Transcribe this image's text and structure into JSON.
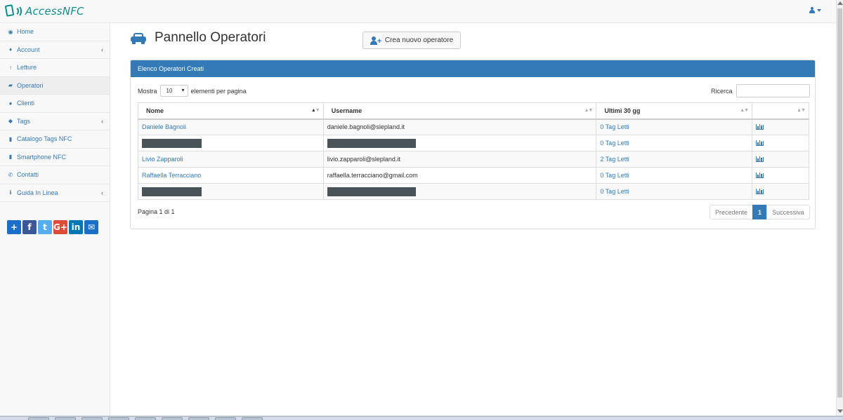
{
  "app": {
    "name": "AccessNFC"
  },
  "sidebar": {
    "items": [
      {
        "label": "Home",
        "icon": "dashboard-icon",
        "glyph": "◉",
        "arrow": ""
      },
      {
        "label": "Account",
        "icon": "male-icon",
        "glyph": "♦",
        "arrow": "‹"
      },
      {
        "label": "Letture",
        "icon": "arrow-up-icon",
        "glyph": "↑",
        "arrow": ""
      },
      {
        "label": "Operatori",
        "icon": "car-icon",
        "glyph": "▰",
        "arrow": ""
      },
      {
        "label": "Clienti",
        "icon": "users-icon",
        "glyph": "●",
        "arrow": ""
      },
      {
        "label": "Tags",
        "icon": "tag-icon",
        "glyph": "◆",
        "arrow": "‹"
      },
      {
        "label": "Catalogo Tags NFC",
        "icon": "book-icon",
        "glyph": "▮",
        "arrow": ""
      },
      {
        "label": "Smartphone NFC",
        "icon": "book-icon",
        "glyph": "▮",
        "arrow": ""
      },
      {
        "label": "Contatti",
        "icon": "phone-icon",
        "glyph": "✆",
        "arrow": ""
      },
      {
        "label": "Guida In Linea",
        "icon": "info-circle-icon",
        "glyph": "ℹ",
        "arrow": "‹"
      }
    ],
    "social": [
      {
        "name": "share-plus-icon",
        "glyph": "+",
        "color": "#1c6fc9"
      },
      {
        "name": "facebook-icon",
        "glyph": "f",
        "color": "#3b5998"
      },
      {
        "name": "twitter-icon",
        "glyph": "t",
        "color": "#55acee"
      },
      {
        "name": "google-plus-icon",
        "glyph": "G+",
        "color": "#dd4b39"
      },
      {
        "name": "linkedin-icon",
        "glyph": "in",
        "color": "#0077b5"
      },
      {
        "name": "email-icon",
        "glyph": "✉",
        "color": "#1c6fc9"
      }
    ]
  },
  "page": {
    "title": "Pannello Operatori",
    "new_button": "Crea nuovo operatore"
  },
  "panel": {
    "heading": "Elenco Operatori Creati",
    "show_label": "Mostra",
    "page_length": "10",
    "per_page_label": "elementi per pagina",
    "search_label": "Ricerca",
    "search_value": "",
    "columns": [
      "Nome",
      "Username",
      "Ultimi 30 gg",
      ""
    ],
    "rows": [
      {
        "name": "Daniele Bagnoli",
        "username": "daniele.bagnoli@slepland.it",
        "reads": "0 Tag Letti",
        "redacted": false
      },
      {
        "name": "",
        "username": "",
        "reads": "0 Tag Letti",
        "redacted": true
      },
      {
        "name": "Livio Zapparoli",
        "username": "livio.zapparoli@slepland.it",
        "reads": "2 Tag Letti",
        "redacted": false
      },
      {
        "name": "Raffaella Terracciano",
        "username": "raffaella.terracciano@gmail.com",
        "reads": "0 Tag Letti",
        "redacted": false
      },
      {
        "name": "",
        "username": "",
        "reads": "0 Tag Letti",
        "redacted": true
      }
    ],
    "page_info": "Pagina 1 di 1",
    "pagination": {
      "prev": "Precedente",
      "current": "1",
      "next": "Successiva"
    }
  },
  "colors": {
    "primary": "#337ab7",
    "brand": "#0f8f8c",
    "redaction": "#4a5358"
  }
}
